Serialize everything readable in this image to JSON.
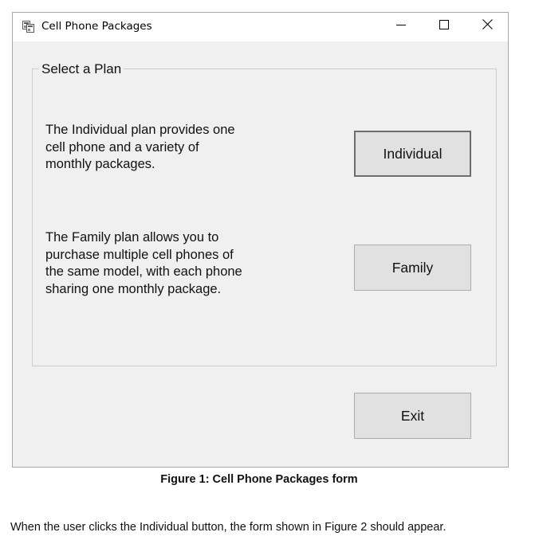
{
  "window": {
    "title": "Cell Phone Packages",
    "icon": "form-app-icon",
    "controls": {
      "minimize_icon": "minimize-icon",
      "maximize_icon": "maximize-icon",
      "close_icon": "close-icon"
    }
  },
  "group": {
    "title": "Select a Plan",
    "individual_description": "The Individual plan provides one\ncell phone and a variety of\nmonthly packages.",
    "family_description": "The Family plan allows you to\npurchase multiple cell phones of\nthe same model, with each phone\nsharing one monthly package."
  },
  "buttons": {
    "individual_label": "Individual",
    "family_label": "Family",
    "exit_label": "Exit"
  },
  "document": {
    "caption": "Figure 1: Cell Phone Packages form",
    "note": "When the user clicks the Individual button, the form shown in Figure 2 should appear."
  },
  "colors": {
    "form_background": "#f0f0f0",
    "titlebar_background": "#ffffff",
    "button_face": "#e1e1e1",
    "button_border": "#adadad",
    "default_button_border": "#6d6d6d"
  }
}
